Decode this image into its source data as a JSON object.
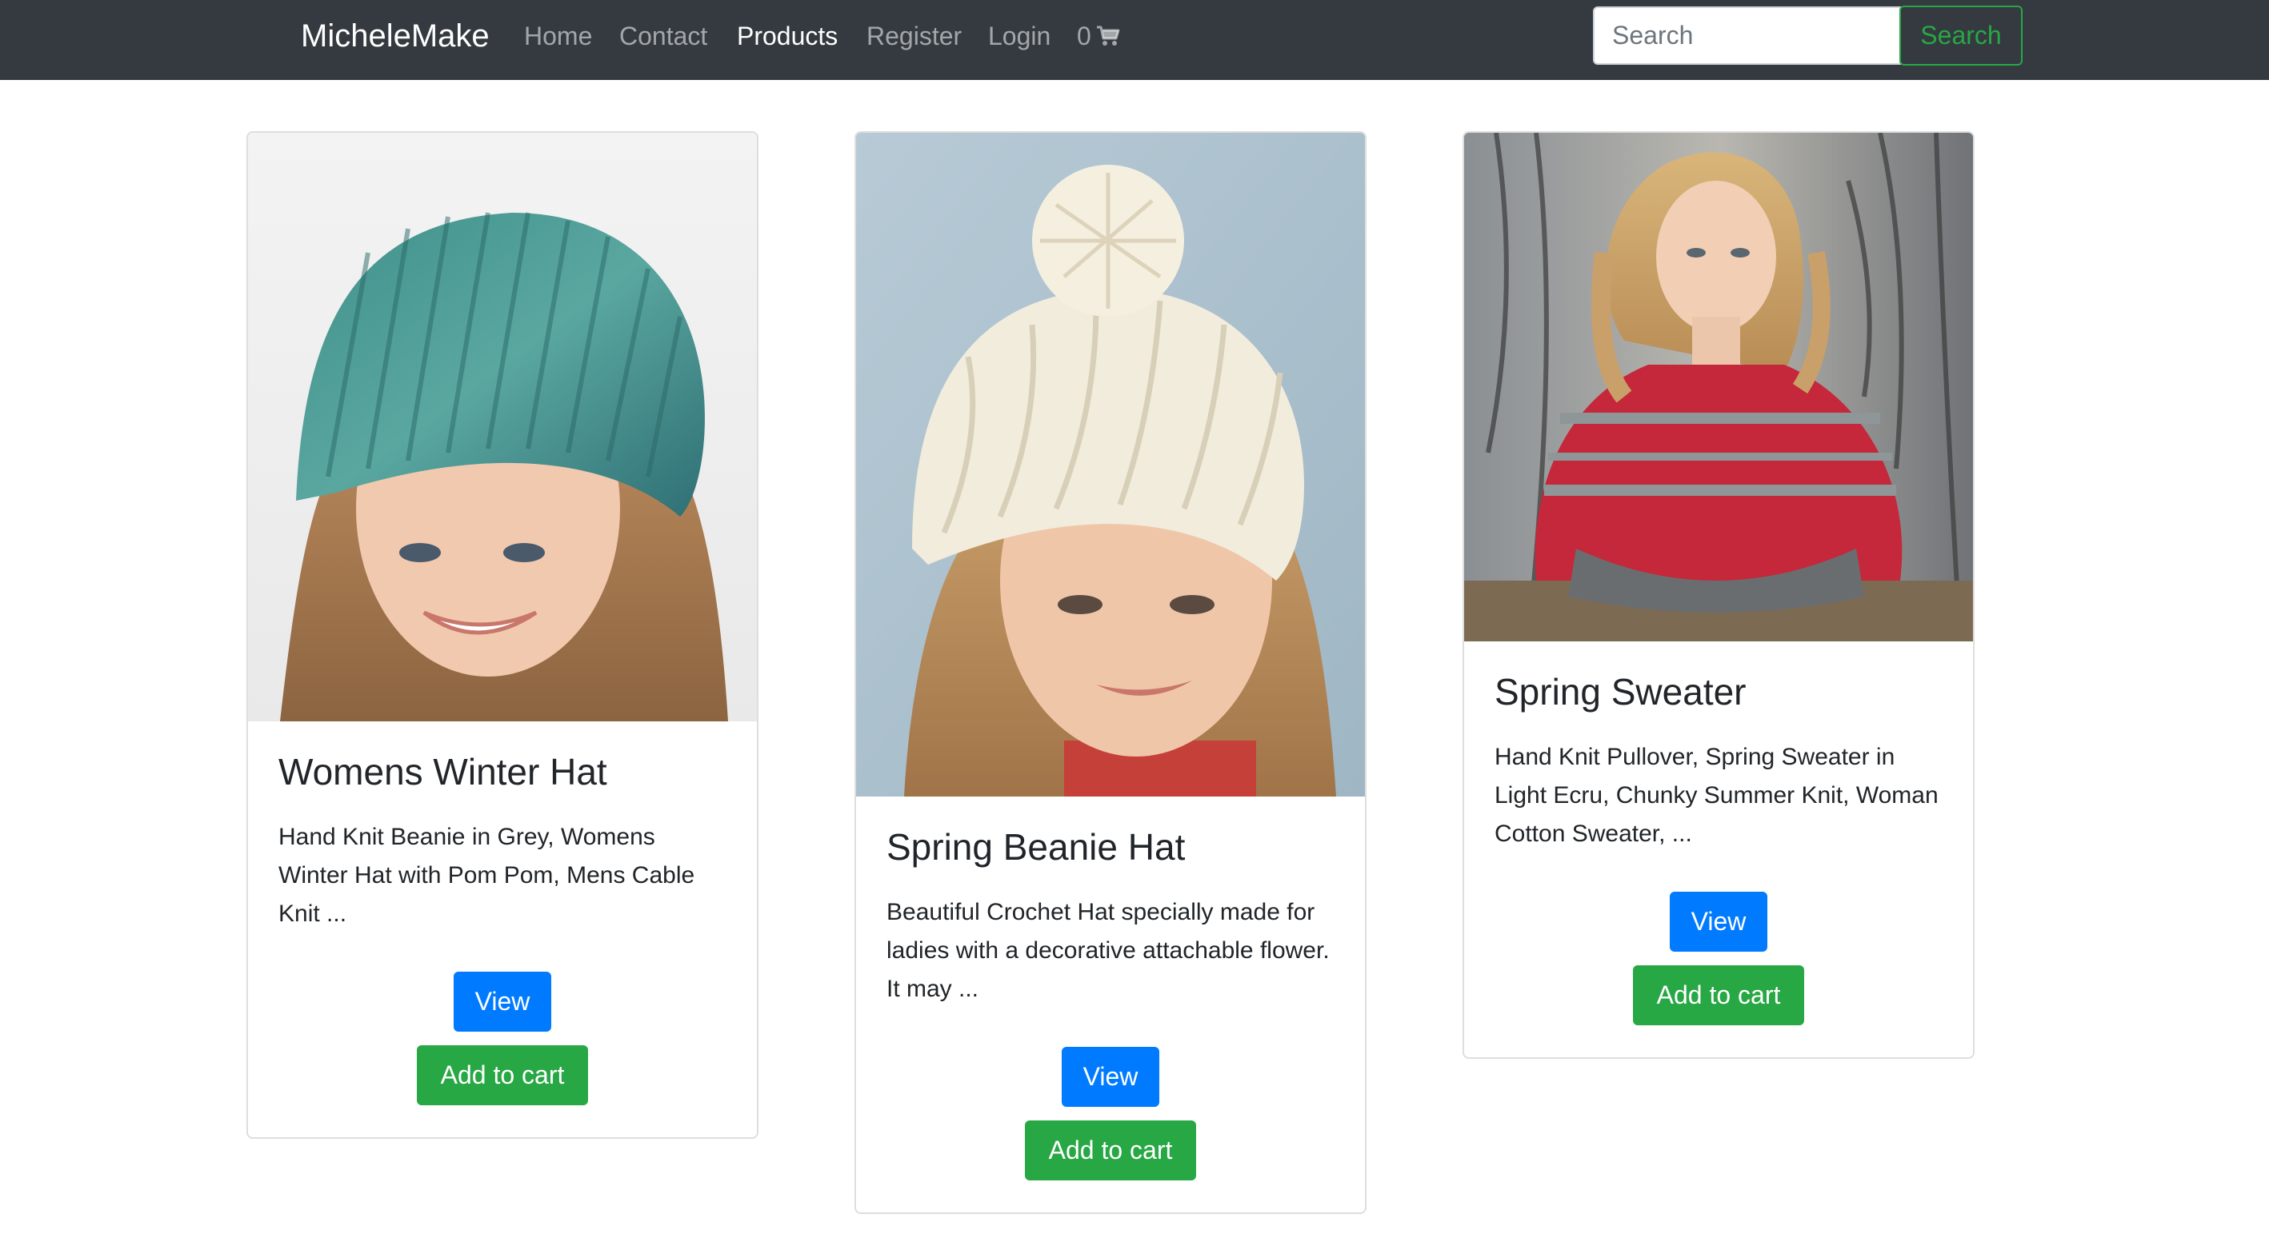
{
  "navbar": {
    "brand": "MicheleMake",
    "links": [
      {
        "label": "Home",
        "active": false
      },
      {
        "label": "Contact",
        "active": false
      },
      {
        "label": "Products",
        "active": true
      },
      {
        "label": "Register",
        "active": false
      },
      {
        "label": "Login",
        "active": false
      }
    ],
    "cart_count": "0",
    "cart_icon": "shopping-cart-icon",
    "search": {
      "placeholder": "Search",
      "value": "",
      "button_label": "Search"
    }
  },
  "products": [
    {
      "title": "Womens Winter Hat",
      "description": "Hand Knit Beanie in Grey, Womens Winter Hat with Pom Pom, Mens Cable Knit ...",
      "image": "woman-teal-knit-beanie-photo",
      "view_label": "View",
      "cart_label": "Add to cart"
    },
    {
      "title": "Spring Beanie Hat",
      "description": "Beautiful Crochet Hat specially made for ladies with a decorative attachable flower. It may ...",
      "image": "woman-cream-pompom-beanie-photo",
      "view_label": "View",
      "cart_label": "Add to cart"
    },
    {
      "title": "Spring Sweater",
      "description": "Hand Knit Pullover, Spring Sweater in Light Ecru, Chunky Summer Knit, Woman Cotton Sweater, ...",
      "image": "woman-red-knit-poncho-photo",
      "view_label": "View",
      "cart_label": "Add to cart"
    }
  ],
  "colors": {
    "navbar_bg": "#343a40",
    "primary": "#007bff",
    "success": "#28a745"
  }
}
